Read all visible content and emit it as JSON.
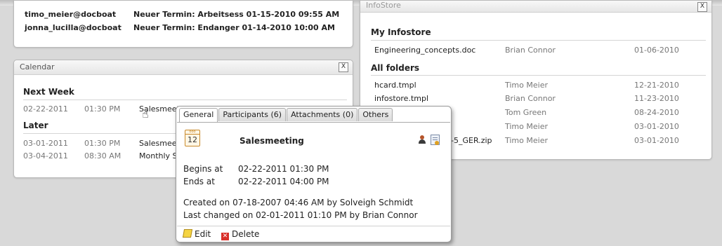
{
  "top_panel": {
    "rows": [
      {
        "from": "timo_meier@docboat",
        "subject": "Neuer Termin: Arbeitsess 01-15-2010 09:55 AM"
      },
      {
        "from": "jonna_lucilla@docboat",
        "subject": "Neuer Termin: Endanger 01-14-2010 10:00 AM"
      }
    ]
  },
  "calendar": {
    "title": "Calendar",
    "close": "X",
    "next_week_label": "Next Week",
    "later_label": "Later",
    "next_week": [
      {
        "date": "02-22-2011",
        "time": "01:30 PM",
        "title": "Salesmeeting"
      }
    ],
    "later": [
      {
        "date": "03-01-2011",
        "time": "01:30 PM",
        "title": "Salesmee"
      },
      {
        "date": "03-04-2011",
        "time": "08:30 AM",
        "title": "Monthly S"
      }
    ]
  },
  "infostore": {
    "title": "InfoStore",
    "close": "X",
    "my_infostore_label": "My Infostore",
    "all_folders_label": "All folders",
    "my_infostore": [
      {
        "name": "Engineering_concepts.doc",
        "owner": "Brian Connor",
        "date": "01-06-2010"
      }
    ],
    "all_folders": [
      {
        "name": "hcard.tmpl",
        "owner": "Timo Meier",
        "date": "12-21-2010"
      },
      {
        "name": "infostore.tmpl",
        "owner": "Brian Connor",
        "date": "11-23-2010"
      },
      {
        "name": "",
        "owner": "Tom Green",
        "date": "08-24-2010"
      },
      {
        "name": "",
        "owner": "Timo Meier",
        "date": "03-01-2010"
      },
      {
        "name": "-5_GER.zip",
        "owner": "Timo Meier",
        "date": "03-01-2010"
      }
    ]
  },
  "popup": {
    "tabs": [
      "General",
      "Participants (6)",
      "Attachments (0)",
      "Others"
    ],
    "active_tab": "General",
    "icon_day": "12",
    "title": "Salesmeeting",
    "begins_label": "Begins at",
    "begins_value": "02-22-2011 01:30 PM",
    "ends_label": "Ends at",
    "ends_value": "02-22-2011 04:00 PM",
    "created": "Created on 07-18-2007 04:46 AM by Solveigh Schmidt",
    "changed": "Last changed on 02-01-2011 01:10 PM by Brian Connor",
    "edit_label": "Edit",
    "delete_label": "Delete"
  },
  "colors": {
    "background": "#d9d9d9",
    "panel": "#ffffff",
    "muted_text": "#777777",
    "delete_red": "#d9302a",
    "calendar_icon": "#c98a2b"
  }
}
